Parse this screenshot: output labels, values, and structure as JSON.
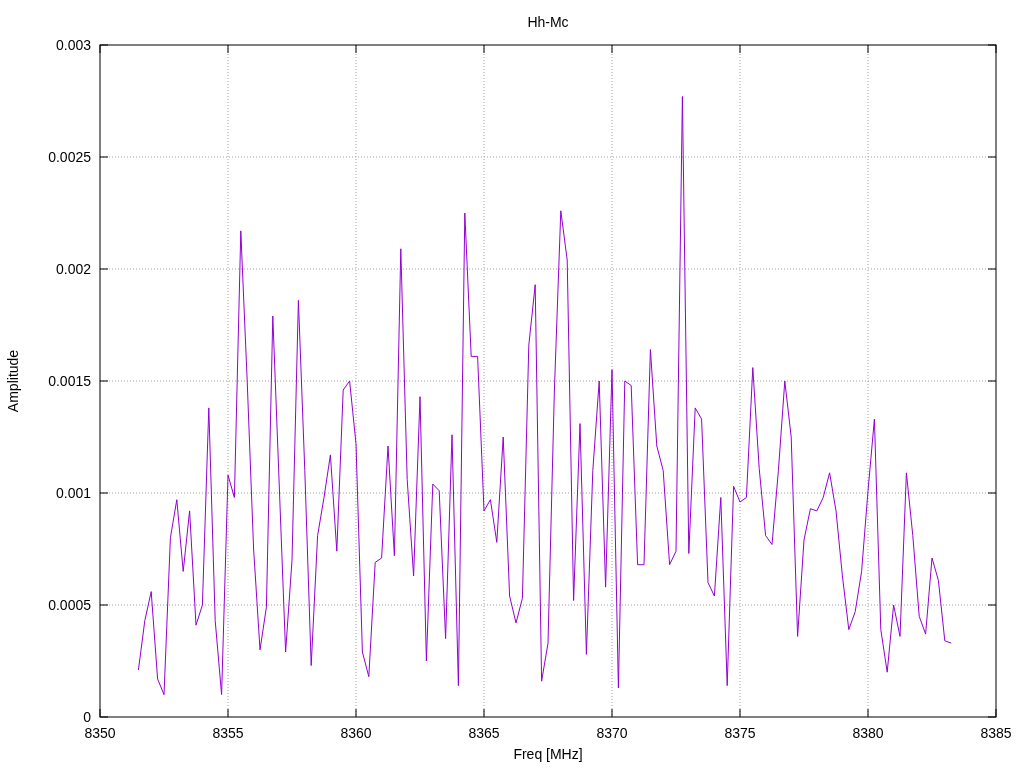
{
  "chart": {
    "chart_data": {
      "type": "line",
      "title": "Hh-Mc",
      "xlabel": "Freq [MHz]",
      "ylabel": "Amplitude",
      "x": [
        8351.5,
        8351.75,
        8352,
        8352.25,
        8352.5,
        8352.75,
        8353,
        8353.25,
        8353.5,
        8353.75,
        8354,
        8354.25,
        8354.5,
        8354.75,
        8355,
        8355.25,
        8355.5,
        8355.75,
        8356,
        8356.25,
        8356.5,
        8356.75,
        8357,
        8357.25,
        8357.5,
        8357.75,
        8358,
        8358.25,
        8358.5,
        8358.75,
        8359,
        8359.25,
        8359.5,
        8359.75,
        8360,
        8360.25,
        8360.5,
        8360.75,
        8361,
        8361.25,
        8361.5,
        8361.75,
        8362,
        8362.25,
        8362.5,
        8362.75,
        8363,
        8363.25,
        8363.5,
        8363.75,
        8364,
        8364.25,
        8364.5,
        8364.75,
        8365,
        8365.25,
        8365.5,
        8365.75,
        8366,
        8366.25,
        8366.5,
        8366.75,
        8367,
        8367.25,
        8367.5,
        8367.75,
        8368,
        8368.25,
        8368.5,
        8368.75,
        8369,
        8369.25,
        8369.5,
        8369.75,
        8370,
        8370.25,
        8370.5,
        8370.75,
        8371,
        8371.25,
        8371.5,
        8371.75,
        8372,
        8372.25,
        8372.5,
        8372.75,
        8373,
        8373.25,
        8373.5,
        8373.75,
        8374,
        8374.25,
        8374.5,
        8374.75,
        8375,
        8375.25,
        8375.5,
        8375.75,
        8376,
        8376.25,
        8376.5,
        8376.75,
        8377,
        8377.25,
        8377.5,
        8377.75,
        8378,
        8378.25,
        8378.5,
        8378.75,
        8379,
        8379.25,
        8379.5,
        8379.75,
        8380,
        8380.25,
        8380.5,
        8380.75,
        8381,
        8381.25,
        8381.5,
        8381.75,
        8382,
        8382.25,
        8382.5,
        8382.75,
        8383,
        8383.25
      ],
      "series": [
        {
          "color": "#9400d3",
          "values": [
            0.00021,
            0.00043,
            0.00056,
            0.00017,
            0.0001,
            0.0008,
            0.00097,
            0.00065,
            0.00092,
            0.00041,
            0.0005,
            0.00138,
            0.00043,
            0.0001,
            0.00108,
            0.00098,
            0.00217,
            0.0015,
            0.00075,
            0.0003,
            0.00049,
            0.00179,
            0.00104,
            0.00029,
            0.0007,
            0.00186,
            0.0011,
            0.00023,
            0.00081,
            0.00098,
            0.00117,
            0.00074,
            0.00146,
            0.0015,
            0.00122,
            0.00029,
            0.00018,
            0.00069,
            0.00071,
            0.00121,
            0.00072,
            0.00209,
            0.00106,
            0.00063,
            0.00143,
            0.00025,
            0.00104,
            0.00101,
            0.00035,
            0.00126,
            0.00014,
            0.00225,
            0.00161,
            0.00161,
            0.00092,
            0.00097,
            0.00078,
            0.00125,
            0.00054,
            0.00042,
            0.00053,
            0.00166,
            0.00193,
            0.00016,
            0.00033,
            0.00146,
            0.00226,
            0.00204,
            0.00052,
            0.00131,
            0.00028,
            0.0011,
            0.0015,
            0.00058,
            0.00155,
            0.00013,
            0.0015,
            0.00148,
            0.00068,
            0.00068,
            0.00164,
            0.00121,
            0.0011,
            0.00068,
            0.00074,
            0.00277,
            0.00073,
            0.00138,
            0.00133,
            0.0006,
            0.00054,
            0.00098,
            0.00014,
            0.00103,
            0.00096,
            0.00098,
            0.00156,
            0.00111,
            0.00081,
            0.00077,
            0.0011,
            0.0015,
            0.00125,
            0.00036,
            0.00079,
            0.00093,
            0.00092,
            0.00098,
            0.00109,
            0.00092,
            0.00063,
            0.00039,
            0.00047,
            0.00065,
            0.00101,
            0.00133,
            0.00039,
            0.0002,
            0.0005,
            0.00036,
            0.00109,
            0.00081,
            0.00045,
            0.00037,
            0.00071,
            0.00061,
            0.00034,
            0.00033
          ]
        }
      ],
      "grid": true,
      "xlim": [
        8350,
        8385
      ],
      "ylim": [
        0,
        0.003
      ],
      "xticks": [
        8350,
        8355,
        8360,
        8365,
        8370,
        8375,
        8380,
        8385
      ],
      "yticks": [
        0,
        0.0005,
        0.001,
        0.0015,
        0.002,
        0.0025,
        0.003
      ]
    }
  }
}
